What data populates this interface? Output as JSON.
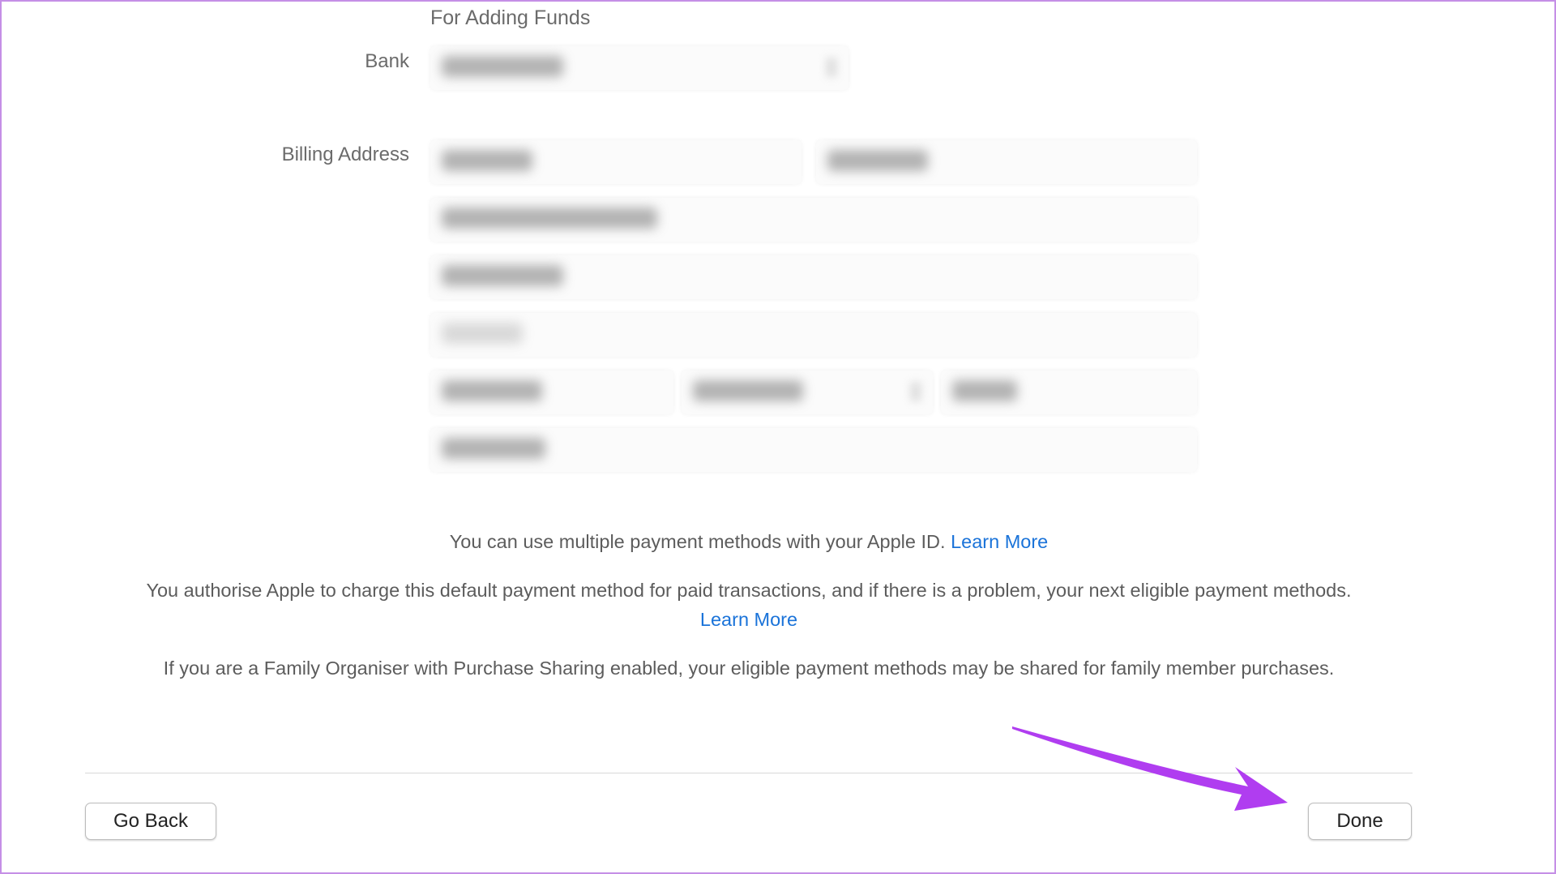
{
  "form": {
    "section_heading": "For Adding Funds",
    "bank_label": "Bank",
    "billing_label": "Billing Address"
  },
  "info": {
    "line1_text": "You can use multiple payment methods with your Apple ID.",
    "line1_link": "Learn More",
    "line2_text": "You authorise Apple to charge this default payment method for paid transactions, and if there is a problem, your next eligible payment methods.",
    "line2_link": "Learn More",
    "line3_text": "If you are a Family Organiser with Purchase Sharing enabled, your eligible payment methods may be shared for family member purchases."
  },
  "footer": {
    "go_back_label": "Go Back",
    "done_label": "Done"
  },
  "colors": {
    "link": "#1a73d9",
    "annotation_arrow": "#b03df0",
    "frame": "#c58fe6"
  },
  "annotation": {
    "icon": "arrow-pointer-icon",
    "target": "done-button"
  }
}
